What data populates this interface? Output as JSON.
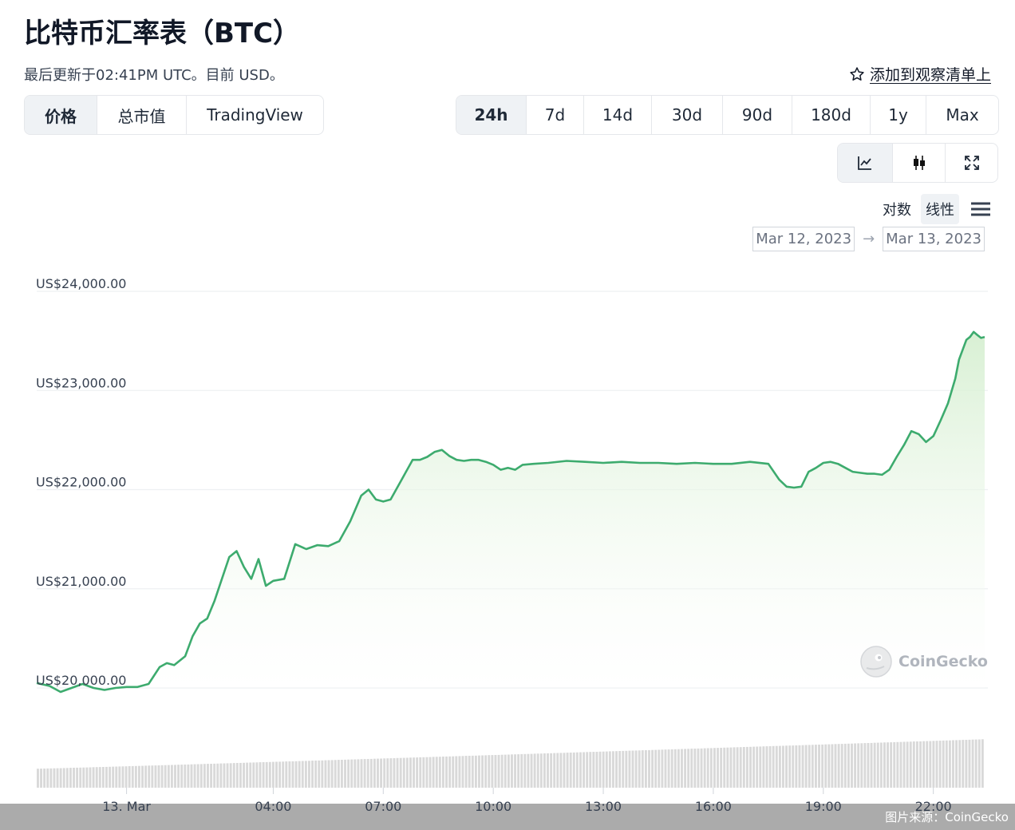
{
  "header": {
    "title": "比特币汇率表（BTC）",
    "subtitle": "最后更新于02:41PM UTC。目前 USD。",
    "watchlist_label": "添加到观察清单上"
  },
  "type_tabs": [
    {
      "label": "价格",
      "active": true
    },
    {
      "label": "总市值",
      "active": false
    },
    {
      "label": "TradingView",
      "active": false
    }
  ],
  "range_tabs": [
    {
      "label": "24h",
      "active": true
    },
    {
      "label": "7d",
      "active": false
    },
    {
      "label": "14d",
      "active": false
    },
    {
      "label": "30d",
      "active": false
    },
    {
      "label": "90d",
      "active": false
    },
    {
      "label": "180d",
      "active": false
    },
    {
      "label": "1y",
      "active": false
    },
    {
      "label": "Max",
      "active": false
    }
  ],
  "view_tabs": [
    {
      "icon": "line-chart-icon",
      "active": true
    },
    {
      "icon": "candlestick-icon",
      "active": false
    },
    {
      "icon": "expand-icon",
      "active": false
    }
  ],
  "scale": {
    "log_label": "对数",
    "linear_label": "线性",
    "active": "linear"
  },
  "date_range": {
    "from": "Mar 12, 2023",
    "to": "Mar 13, 2023",
    "arrow": "→"
  },
  "watermark": "CoinGecko",
  "credit": "图片来源：CoinGecko",
  "colors": {
    "line": "#3dab6e",
    "fill": "#e2f3de",
    "grid": "#eef0f2",
    "volume": "#d9d9d9",
    "bottom_bar": "#ababab",
    "active_tab": "#eff2f5"
  },
  "chart_data": {
    "type": "line",
    "title": "",
    "xlabel": "",
    "ylabel": "",
    "ylim": [
      20000,
      24000
    ],
    "yticks": [
      {
        "value": 24000,
        "label": "US$24,000.00"
      },
      {
        "value": 23000,
        "label": "US$23,000.00"
      },
      {
        "value": 22000,
        "label": "US$22,000.00"
      },
      {
        "value": 21000,
        "label": "US$21,000.00"
      },
      {
        "value": 20000,
        "label": "US$20,000.00"
      }
    ],
    "xlim": [
      -2.45,
      23.4
    ],
    "xticks": [
      {
        "value": 0,
        "label": "13. Mar"
      },
      {
        "value": 4,
        "label": "04:00"
      },
      {
        "value": 7,
        "label": "07:00"
      },
      {
        "value": 10,
        "label": "10:00"
      },
      {
        "value": 13,
        "label": "13:00"
      },
      {
        "value": 16,
        "label": "16:00"
      },
      {
        "value": 19,
        "label": "19:00"
      },
      {
        "value": 22,
        "label": "22:00"
      }
    ],
    "grid": true,
    "area_fill": true,
    "series": [
      {
        "x": [
          -2.45,
          -2.1,
          -1.8,
          -1.5,
          -1.2,
          -0.9,
          -0.6,
          -0.3,
          0.0,
          0.3,
          0.6,
          0.9,
          1.1,
          1.3,
          1.6,
          1.8,
          2.0,
          2.2,
          2.4,
          2.6,
          2.8,
          3.0,
          3.2,
          3.4,
          3.6,
          3.8,
          4.0,
          4.3,
          4.6,
          4.9,
          5.2,
          5.5,
          5.8,
          6.1,
          6.4,
          6.6,
          6.8,
          7.0,
          7.2,
          7.5,
          7.8,
          8.0,
          8.2,
          8.4,
          8.6,
          8.8,
          9.0,
          9.2,
          9.4,
          9.6,
          9.8,
          10.0,
          10.2,
          10.4,
          10.6,
          10.8,
          11.1,
          11.5,
          12.0,
          12.5,
          13.0,
          13.5,
          14.0,
          14.5,
          15.0,
          15.5,
          16.0,
          16.5,
          17.0,
          17.5,
          17.8,
          18.0,
          18.2,
          18.4,
          18.6,
          18.8,
          19.0,
          19.2,
          19.4,
          19.6,
          19.8,
          20.0,
          20.2,
          20.4,
          20.6,
          20.8,
          21.0,
          21.2,
          21.4,
          21.6,
          21.8,
          22.0,
          22.2,
          22.4,
          22.6,
          22.7,
          22.9,
          23.0,
          23.1,
          23.2,
          23.3,
          23.4
        ],
        "y": [
          20050,
          20020,
          19960,
          20000,
          20040,
          20000,
          19980,
          20000,
          20010,
          20010,
          20040,
          20210,
          20250,
          20230,
          20320,
          20520,
          20650,
          20700,
          20880,
          21100,
          21320,
          21380,
          21220,
          21100,
          21300,
          21030,
          21080,
          21100,
          21450,
          21400,
          21440,
          21430,
          21480,
          21680,
          21940,
          22000,
          21900,
          21880,
          21900,
          22100,
          22300,
          22300,
          22330,
          22380,
          22400,
          22340,
          22300,
          22290,
          22300,
          22300,
          22280,
          22250,
          22200,
          22220,
          22200,
          22250,
          22260,
          22270,
          22290,
          22280,
          22270,
          22280,
          22270,
          22270,
          22260,
          22270,
          22260,
          22260,
          22280,
          22260,
          22100,
          22030,
          22020,
          22030,
          22180,
          22220,
          22270,
          22280,
          22260,
          22220,
          22180,
          22170,
          22160,
          22160,
          22150,
          22200,
          22330,
          22450,
          22590,
          22560,
          22480,
          22540,
          22700,
          22870,
          23120,
          23310,
          23510,
          23540,
          23590,
          23560,
          23530,
          23540
        ]
      }
    ],
    "volume": {
      "x_start": -2.45,
      "x_end": 23.4,
      "min": 0.29,
      "max": 0.74
    }
  }
}
